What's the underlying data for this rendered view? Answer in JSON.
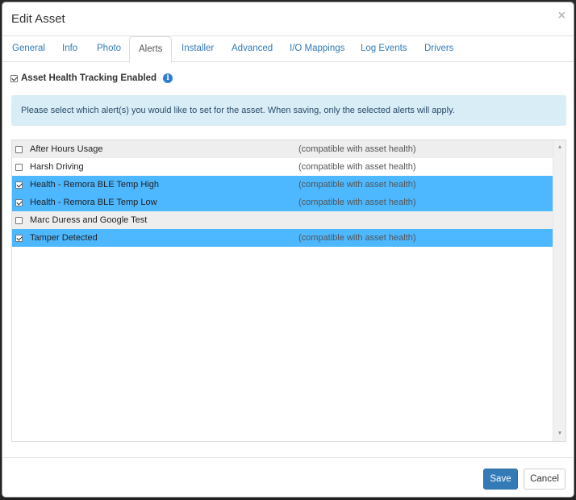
{
  "modal": {
    "title": "Edit Asset",
    "close_label": "×"
  },
  "tabs": [
    {
      "label": "General"
    },
    {
      "label": "Info"
    },
    {
      "label": "Photo"
    },
    {
      "label": "Alerts",
      "active": true
    },
    {
      "label": "Installer"
    },
    {
      "label": "Advanced"
    },
    {
      "label": "I/O Mappings"
    },
    {
      "label": "Log Events"
    },
    {
      "label": "Drivers"
    }
  ],
  "tracking": {
    "label": "Asset Health Tracking Enabled",
    "checked": true,
    "info_icon": "info-circle-icon"
  },
  "info_message": "Please select which alert(s) you would like to set for the asset. When saving, only the selected alerts will apply.",
  "alerts": [
    {
      "name": "After Hours Usage",
      "note": "(compatible with asset health)",
      "checked": false
    },
    {
      "name": "Harsh Driving",
      "note": "(compatible with asset health)",
      "checked": false
    },
    {
      "name": "Health - Remora BLE Temp High",
      "note": "(compatible with asset health)",
      "checked": true
    },
    {
      "name": "Health - Remora BLE Temp Low",
      "note": "(compatible with asset health)",
      "checked": true
    },
    {
      "name": "Marc Duress and Google Test",
      "note": "",
      "checked": false
    },
    {
      "name": "Tamper Detected",
      "note": "(compatible with asset health)",
      "checked": true
    }
  ],
  "footer": {
    "save_label": "Save",
    "cancel_label": "Cancel"
  },
  "colors": {
    "selected_row": "#4db8ff",
    "primary_button": "#337ab7",
    "info_bg": "#d9edf7"
  }
}
